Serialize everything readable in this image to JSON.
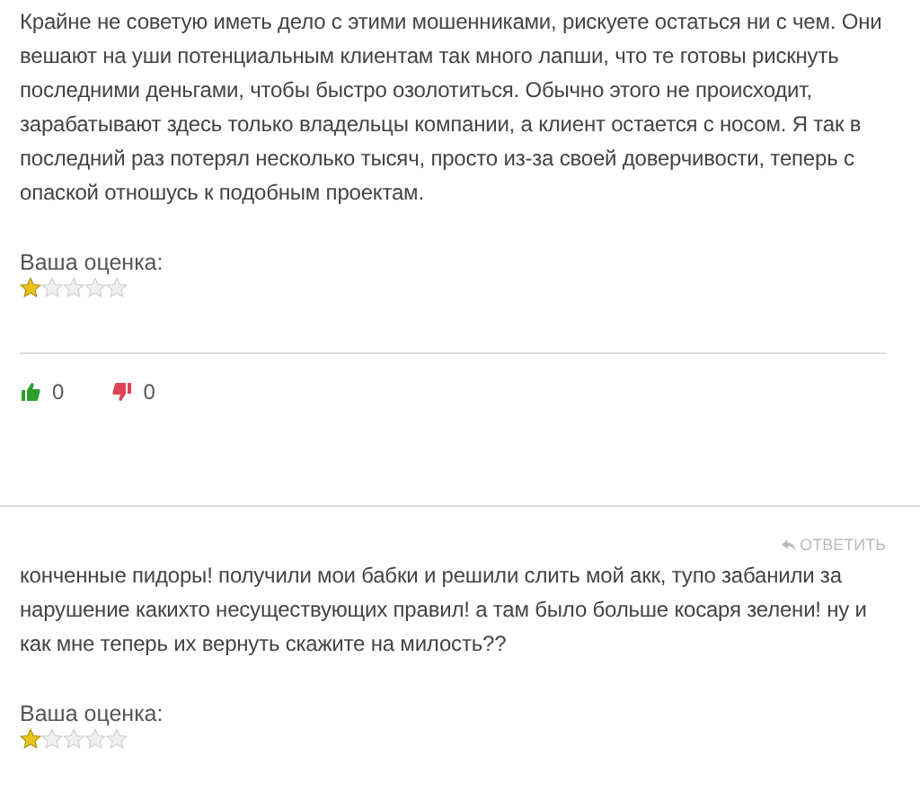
{
  "comments": [
    {
      "text": "Крайне не советую иметь дело с этими мошенниками, рискуете остаться ни с чем. Они вешают на уши потенциальным клиентам так много лапши, что те готовы рискнуть последними деньгами, чтобы быстро озолотиться. Обычно этого не происходит, зарабатывают здесь только владельцы компании, а клиент остается с носом. Я так в последний раз потерял несколько тысяч, просто из-за своей доверчивости, теперь с опаской отношусь к подобным проектам.",
      "rating_label": "Ваша оценка:",
      "stars": 1,
      "likes": "0",
      "dislikes": "0"
    },
    {
      "reply": "ОТВЕТИТЬ",
      "text": "конченные пидоры! получили мои бабки и решили слить мой акк, тупо забанили за нарушение какихто несуществующих правил! а там было больше косаря зелени! ну и как мне теперь их вернуть скажите на милость??",
      "rating_label": "Ваша оценка:",
      "stars": 1
    }
  ]
}
